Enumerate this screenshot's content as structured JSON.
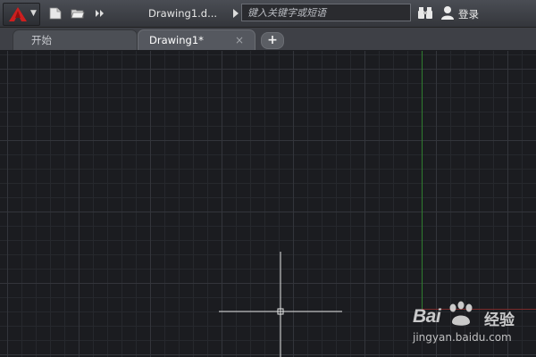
{
  "titlebar": {
    "doc_title": "Drawing1.d...",
    "search_placeholder": "键入关键字或短语",
    "login_label": "登录"
  },
  "tabs": [
    {
      "label": "开始",
      "active": false
    },
    {
      "label": "Drawing1*",
      "active": true,
      "close_label": "×"
    }
  ],
  "tab_add_label": "+",
  "watermark": {
    "brand": "Bai",
    "brand2": "经验",
    "url": "jingyan.baidu.com"
  },
  "colors": {
    "canvas_bg": "#1b1c20",
    "grid_major": "#33353b",
    "grid_minor": "#26282d",
    "y_axis": "#2f7d2f",
    "x_axis": "#7a2a2a",
    "logo_red": "#cc1f1f"
  },
  "icons": [
    "app-logo-icon",
    "new-file-icon",
    "open-folder-icon",
    "more-icon",
    "binoculars-icon",
    "user-icon",
    "crosshair-cursor-icon"
  ]
}
